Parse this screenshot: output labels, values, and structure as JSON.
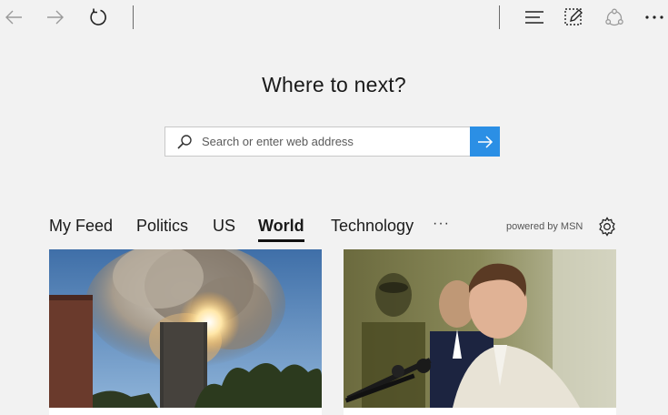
{
  "toolbar": {
    "icons": [
      "back-arrow-icon",
      "forward-arrow-icon",
      "refresh-icon",
      "hub-icon",
      "web-note-icon",
      "share-icon",
      "more-icon"
    ]
  },
  "main": {
    "heading": "Where to next?",
    "search": {
      "placeholder": "Search or enter web address",
      "value": ""
    }
  },
  "feed": {
    "tabs": [
      {
        "label": "My Feed",
        "active": false
      },
      {
        "label": "Politics",
        "active": false
      },
      {
        "label": "US",
        "active": false
      },
      {
        "label": "World",
        "active": true
      },
      {
        "label": "Technology",
        "active": false
      }
    ],
    "more": "···",
    "powered_by": "powered by MSN"
  },
  "colors": {
    "background": "#f2f2f2",
    "accent": "#2b8fe5",
    "text": "#1a1a1a"
  }
}
